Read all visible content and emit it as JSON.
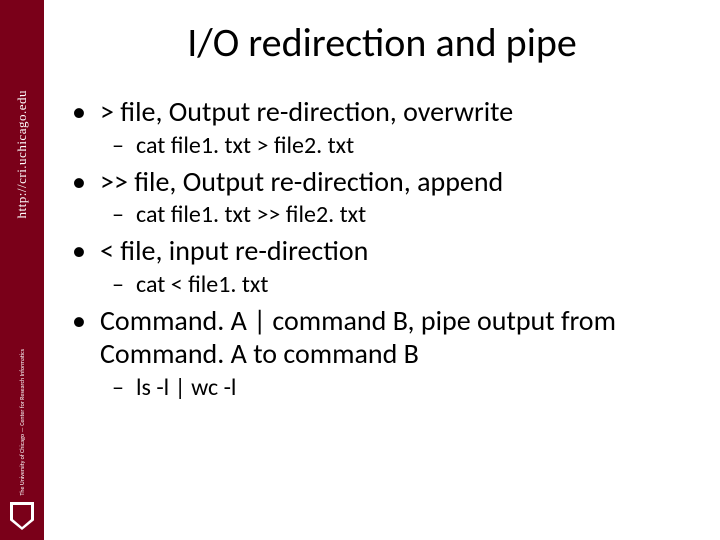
{
  "rail": {
    "url": "http://cri.uchicago.edu",
    "logo_alt": "The University of Chicago — Center for Research Informatics"
  },
  "title": "I/O redirection and pipe",
  "items": [
    {
      "level": 1,
      "text": "> file, Output re-direction, overwrite"
    },
    {
      "level": 2,
      "text": "cat file1. txt > file2. txt"
    },
    {
      "level": 1,
      "text": ">> file, Output re-direction, append"
    },
    {
      "level": 2,
      "text": "cat file1. txt >> file2. txt"
    },
    {
      "level": 1,
      "text": "< file, input re-direction"
    },
    {
      "level": 2,
      "text": "cat < file1. txt"
    },
    {
      "level": 1,
      "text": "Command. A | command B, pipe output from Command. A to command B"
    },
    {
      "level": 2,
      "text": "ls -l | wc -l"
    }
  ]
}
